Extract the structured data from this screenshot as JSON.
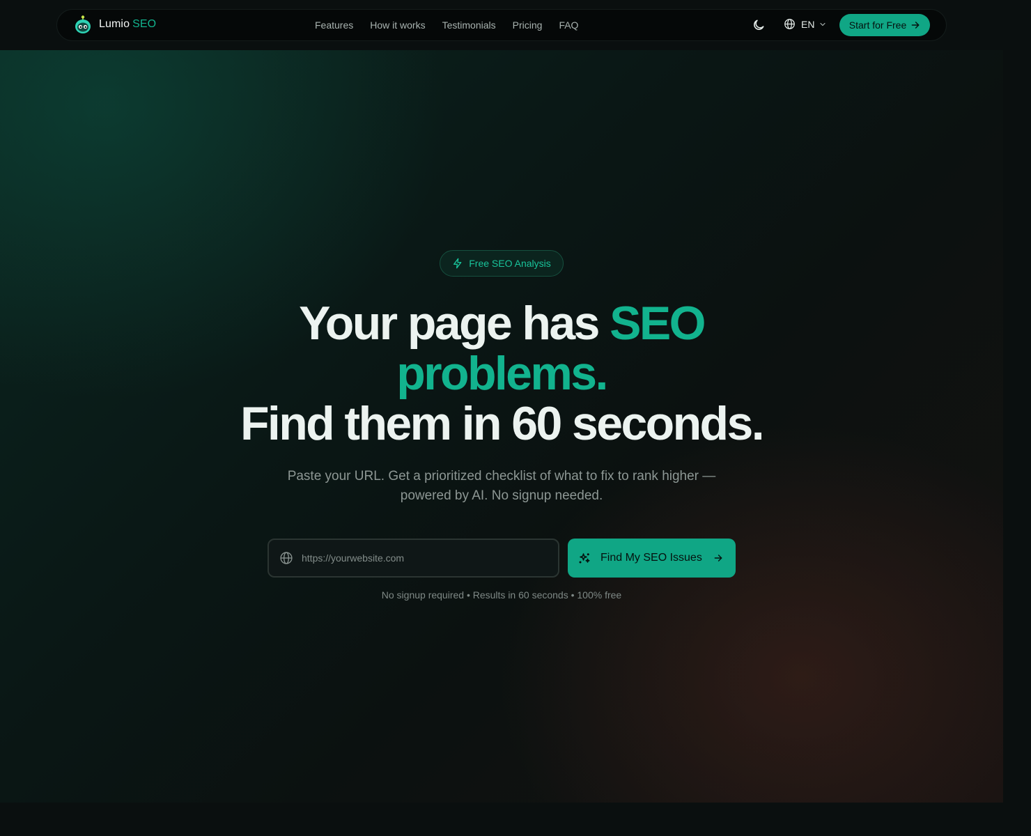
{
  "brand": {
    "name": "Lumio",
    "accent_name": "SEO",
    "accent_color": "#12b38e"
  },
  "nav": {
    "links": [
      "Features",
      "How it works",
      "Testimonials",
      "Pricing",
      "FAQ"
    ],
    "theme_icon": "moon-icon",
    "language": "EN",
    "cta_label": "Start for Free"
  },
  "hero": {
    "badge": "Free SEO Analysis",
    "headline": {
      "line1_prefix": "Your page has ",
      "line1_highlight": "SEO",
      "line2_highlight": "problems.",
      "line3": "Find them in 60 seconds."
    },
    "subtext": "Paste your URL. Get a prioritized checklist of what to fix to rank higher — powered by AI. No signup needed.",
    "url_input": {
      "placeholder": "https://yourwebsite.com",
      "value": ""
    },
    "submit_label": "Find My SEO Issues",
    "footnote": "No signup required • Results in 60 seconds • 100% free"
  },
  "colors": {
    "primary": "#10a685",
    "background": "#0a0f0f",
    "text": "#ecf3f0",
    "muted": "#8d9794"
  }
}
